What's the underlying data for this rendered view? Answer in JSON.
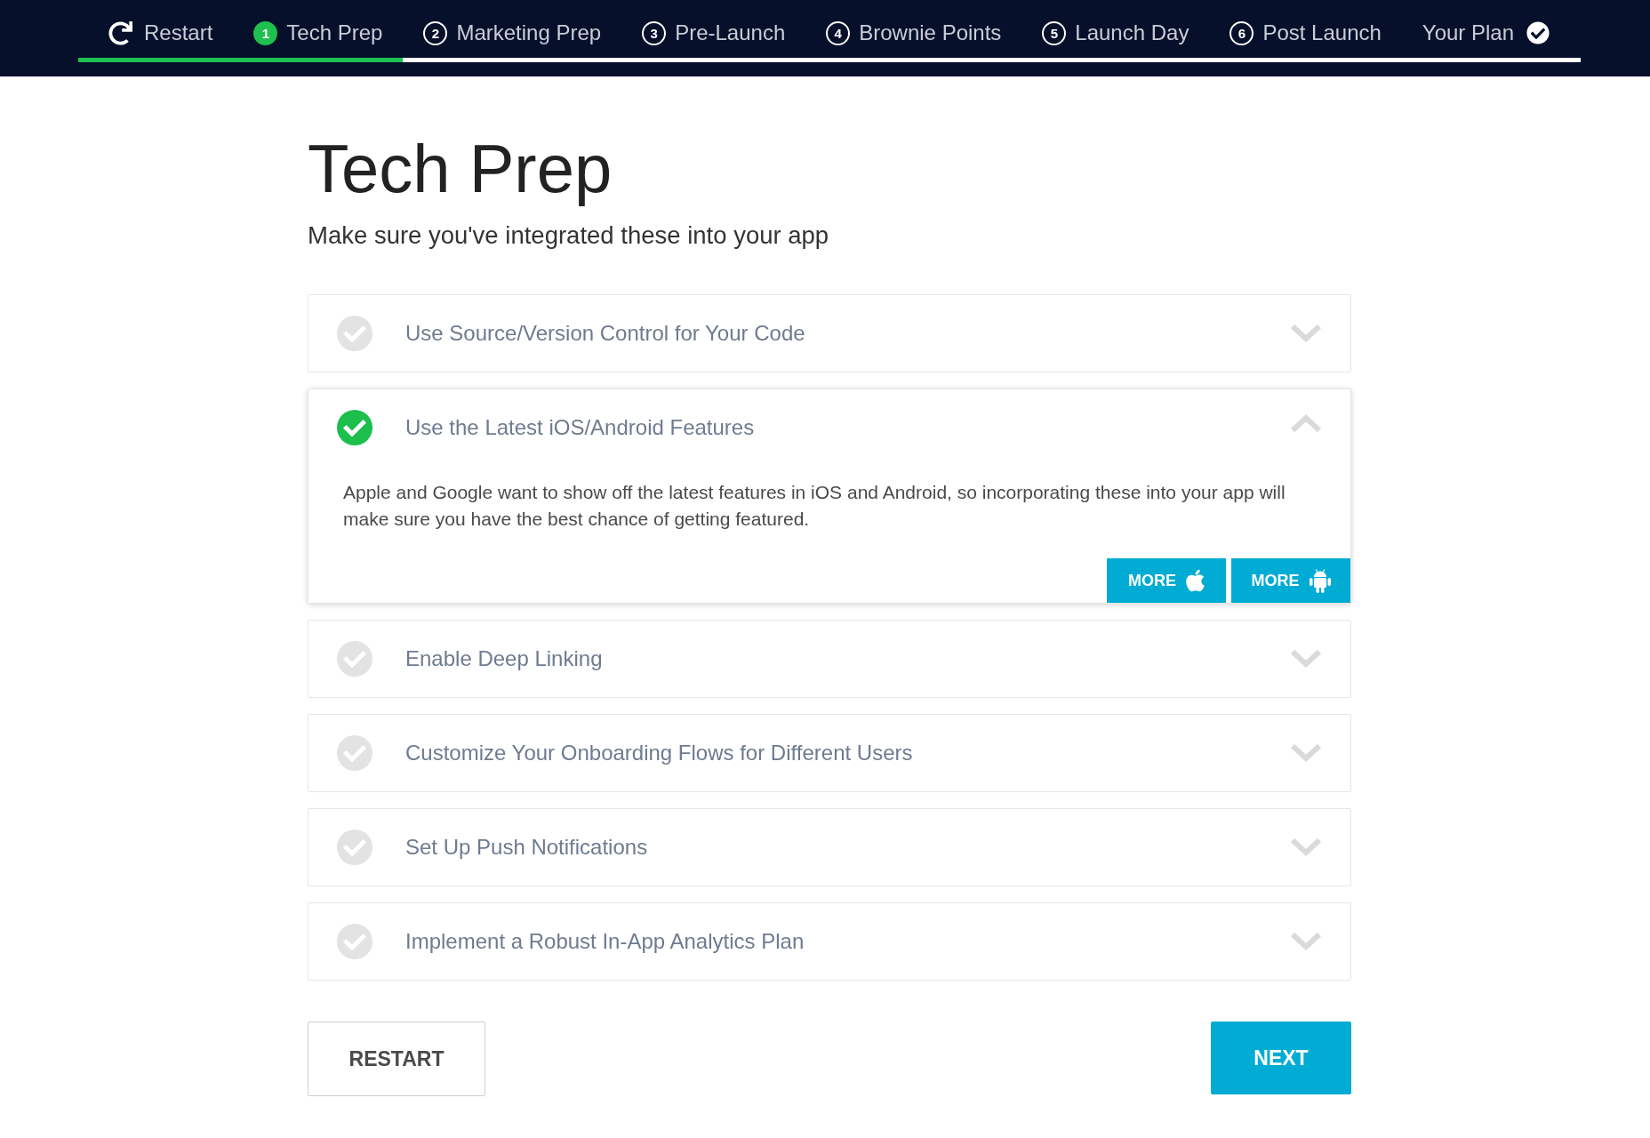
{
  "nav_items": [
    {
      "kind": "restart",
      "label": "Restart",
      "selected": false
    },
    {
      "kind": "step",
      "number": "1",
      "label": "Tech Prep",
      "selected": true
    },
    {
      "kind": "step",
      "number": "2",
      "label": "Marketing Prep",
      "selected": false
    },
    {
      "kind": "step",
      "number": "3",
      "label": "Pre-Launch",
      "selected": false
    },
    {
      "kind": "step",
      "number": "4",
      "label": "Brownie Points",
      "selected": false
    },
    {
      "kind": "step",
      "number": "5",
      "label": "Launch Day",
      "selected": false
    },
    {
      "kind": "step",
      "number": "6",
      "label": "Post Launch",
      "selected": false
    },
    {
      "kind": "plan",
      "label": "Your Plan",
      "selected": false
    }
  ],
  "progress": {
    "level": 0.216
  },
  "page": {
    "title": "Tech Prep",
    "subtitle": "Make sure you've integrated these into your app"
  },
  "items": [
    {
      "title": "Use Source/Version Control for Your Code",
      "checked": false,
      "expanded": false
    },
    {
      "title": "Use the Latest iOS/Android Features",
      "checked": true,
      "expanded": true,
      "description": "Apple and Google want to show off the latest features in iOS and Android, so incorporating these into your app will make sure you have the best chance of getting featured.",
      "links": [
        {
          "kind": "apple",
          "label": "MORE"
        },
        {
          "kind": "android",
          "label": "MORE"
        }
      ]
    },
    {
      "title": "Enable Deep Linking",
      "checked": false,
      "expanded": false
    },
    {
      "title": "Customize Your Onboarding Flows for Different Users",
      "checked": false,
      "expanded": false
    },
    {
      "title": "Set Up Push Notifications",
      "checked": false,
      "expanded": false
    },
    {
      "title": "Implement a Robust In-App Analytics Plan",
      "checked": false,
      "expanded": false
    }
  ],
  "footer": {
    "buttons": [
      {
        "kind": "secondary",
        "label": "RESTART"
      },
      {
        "kind": "primary",
        "label": "NEXT"
      }
    ]
  }
}
